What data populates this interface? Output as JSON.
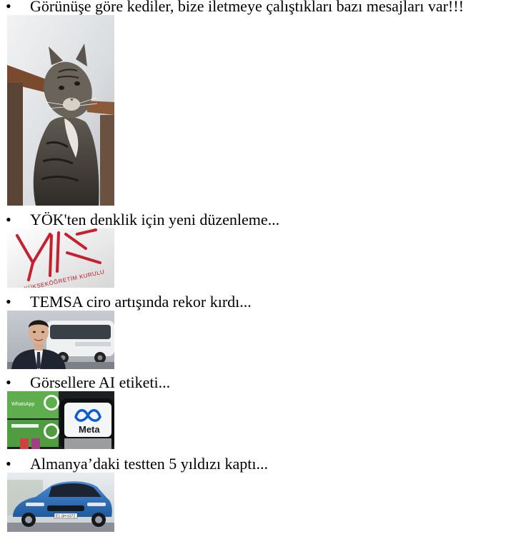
{
  "news": [
    {
      "headline": "Görünüşe göre kediler, bize iletmeye çalıştıkları bazı mesajları var!!!",
      "image": "tabby-cat-photo"
    },
    {
      "headline": "YÖK'ten denklik için yeni düzenleme...",
      "image": "yok-logo-photo",
      "image_text": "YÜKSEKÖĞRETİM KURULU"
    },
    {
      "headline": "TEMSA ciro artışında rekor kırdı...",
      "image": "executive-and-bus-photo"
    },
    {
      "headline": "Görsellere AI etiketi...",
      "image": "meta-whatsapp-phones-photo",
      "image_text": "Meta",
      "image_text_2": "WhatsApp"
    },
    {
      "headline": "Almanya’daki testten 5 yıldızı kaptı...",
      "image": "blue-car-photo",
      "image_text": "E1-SH 6372"
    }
  ],
  "colors": {
    "text": "#000000",
    "background": "#ffffff",
    "yok_red": "#c4202f",
    "car_blue": "#2f6fb8"
  }
}
